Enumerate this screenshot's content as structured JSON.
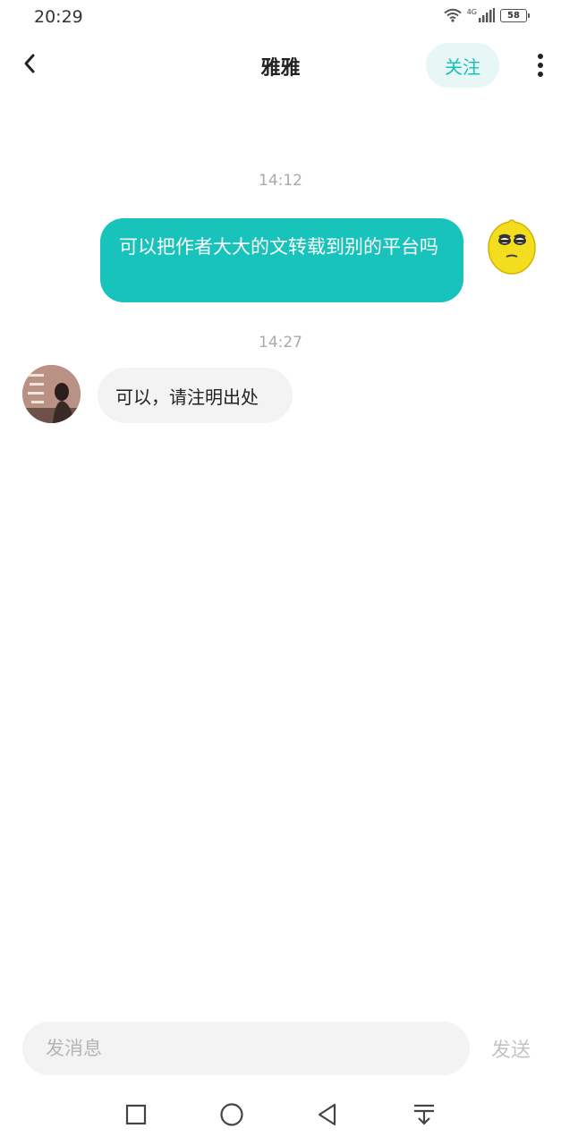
{
  "status_bar": {
    "time": "20:29",
    "network": "4G",
    "battery": "58"
  },
  "header": {
    "title": "雅雅",
    "follow_label": "关注"
  },
  "messages": [
    {
      "time": "14:12",
      "sender": "self",
      "text": "可以把作者大大的文转载到别的平台吗"
    },
    {
      "time": "14:27",
      "sender": "other",
      "text": "可以，请注明出处"
    }
  ],
  "composer": {
    "placeholder": "发消息",
    "send_label": "发送"
  },
  "colors": {
    "accent": "#17c3bb",
    "follow_bg": "#e6f7f6",
    "received_bubble": "#f3f3f3"
  },
  "icons": {
    "back": "chevron-left-icon",
    "more": "more-vertical-icon",
    "self_avatar": "lemon-emoji-icon",
    "nav": [
      "square-icon",
      "circle-icon",
      "triangle-back-icon",
      "pull-down-icon"
    ]
  }
}
